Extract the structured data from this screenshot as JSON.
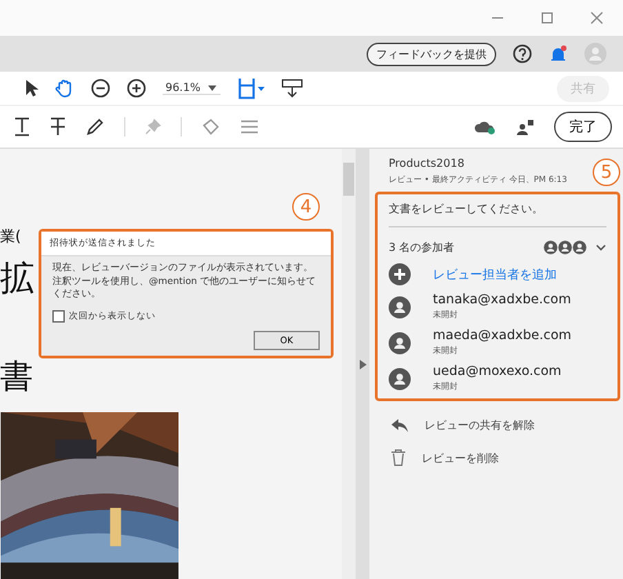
{
  "header": {
    "feedback_button": "フィードバックを提供"
  },
  "toolbar": {
    "zoom": "96.1%",
    "share_button": {
      "label": "共有",
      "disabled": true
    }
  },
  "comment_toolbar": {
    "done_button": "完了"
  },
  "document": {
    "fragments": [
      "業(",
      "拡",
      "書"
    ]
  },
  "dialog": {
    "callout": "4",
    "title": "招待状が送信されました",
    "message": "現在、レビューバージョンのファイルが表示されています。注釈ツールを使用し、@mention で他のユーザーに知らせてください。",
    "checkbox": {
      "label": "次回から表示しない",
      "checked": false
    },
    "ok_button": "OK"
  },
  "review_panel": {
    "file": "Products2018",
    "meta": "レビュー • 最終アクティビティ 今日、PM 6:13",
    "callout": "5",
    "prompt": "文書をレビューしてください。",
    "participants_count": "3 名の参加者",
    "add_reviewer": "レビュー担当者を追加",
    "participants": [
      {
        "email": "tanaka@xadxbe.com",
        "status": "未開封"
      },
      {
        "email": "maeda@xadxbe.com",
        "status": "未開封"
      },
      {
        "email": "ueda@moxexo.com",
        "status": "未開封"
      }
    ],
    "actions": [
      {
        "label": "レビューの共有を解除",
        "kind": "unshare"
      },
      {
        "label": "レビューを削除",
        "kind": "delete"
      }
    ]
  }
}
